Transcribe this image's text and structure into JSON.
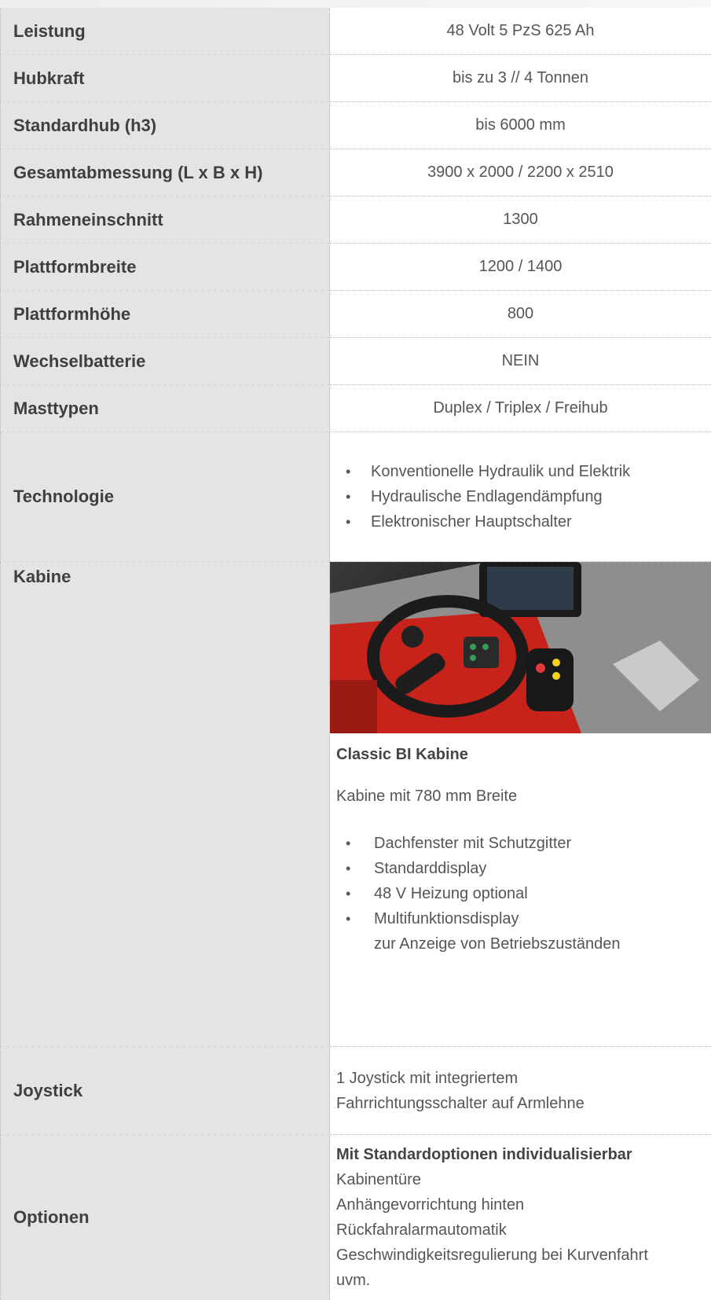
{
  "rows": [
    {
      "label": "Leistung",
      "value": "48 Volt  5 PzS 625 Ah"
    },
    {
      "label": "Hubkraft",
      "value": "bis zu 3 // 4 Tonnen"
    },
    {
      "label": "Standardhub (h3)",
      "value": "bis 6000 mm"
    },
    {
      "label": "Gesamtabmessung (L x B x H)",
      "value": "3900 x 2000 / 2200 x 2510"
    },
    {
      "label": "Rahmeneinschnitt",
      "value": "1300"
    },
    {
      "label": "Plattformbreite",
      "value": "1200 / 1400"
    },
    {
      "label": "Plattformhöhe",
      "value": "800"
    },
    {
      "label": "Wechselbatterie",
      "value": "NEIN"
    },
    {
      "label": "Masttypen",
      "value": "Duplex / Triplex / Freihub"
    }
  ],
  "technologie": {
    "label": "Technologie",
    "items": [
      "Konventionelle Hydraulik und Elektrik",
      "Hydraulische Endlagendämpfung",
      "Elektronischer Hauptschalter"
    ]
  },
  "kabine": {
    "label": "Kabine",
    "title": "Classic BI Kabine",
    "subtitle": "Kabine mit 780 mm Breite",
    "items": [
      "Dachfenster mit Schutzgitter",
      "Standarddisplay",
      "48 V Heizung optional",
      "Multifunktionsdisplay",
      "zur Anzeige von Betriebszuständen"
    ]
  },
  "joystick": {
    "label": "Joystick",
    "lines": [
      "1 Joystick mit integriertem",
      "Fahrrichtungsschalter auf Armlehne"
    ]
  },
  "optionen": {
    "label": "Optionen",
    "title": "Mit Standardoptionen individualisierbar",
    "lines": [
      "Kabinentüre",
      "Anhängevorrichtung hinten",
      "Rückfahralarmautomatik",
      "Geschwindigkeitsregulierung bei Kurvenfahrt",
      "uvm."
    ]
  },
  "colors": {
    "label_bg": "#e4e4e4",
    "label_text": "#3f3f3f",
    "value_text": "#555555",
    "cab_red": "#c8231b"
  }
}
